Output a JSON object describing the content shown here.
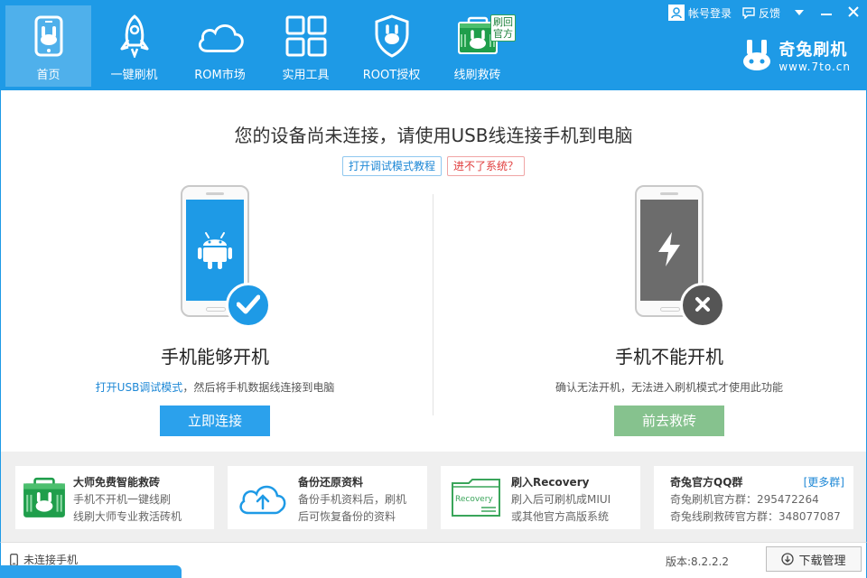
{
  "nav": {
    "items": [
      {
        "label": "首页",
        "icon": "rabbit-phone-icon",
        "active": true
      },
      {
        "label": "一键刷机",
        "icon": "rocket-icon"
      },
      {
        "label": "ROM市场",
        "icon": "cloud-icon"
      },
      {
        "label": "实用工具",
        "icon": "grid-icon"
      },
      {
        "label": "ROOT授权",
        "icon": "shield-icon"
      },
      {
        "label": "线刷救砖",
        "icon": "rescue-kit-icon",
        "badge": "刷回官方"
      }
    ]
  },
  "window_controls": {
    "login_label": "帐号登录",
    "feedback_label": "反馈"
  },
  "brand": {
    "name": "奇兔刷机",
    "url": "www.7to.cn"
  },
  "main": {
    "headline": "您的设备尚未连接，请使用USB线连接手机到电脑",
    "tag_tutorial": "打开调试模式教程",
    "tag_no_system": "进不了系统？",
    "left": {
      "title": "手机能够开机",
      "desc_link": "打开USB调试模式",
      "desc_rest": "，然后将手机数据线连接到电脑",
      "button": "立即连接"
    },
    "right": {
      "title": "手机不能开机",
      "desc": "确认无法开机，无法进入刷机模式才使用此功能",
      "button": "前去救砖"
    }
  },
  "cards": [
    {
      "title": "大师免费智能救砖",
      "line1": "手机不开机一键线刷",
      "line2": "线刷大师专业救活砖机",
      "icon": "rescue-kit-icon"
    },
    {
      "title": "备份还原资料",
      "line1": "备份手机资料后，刷机",
      "line2": "后可恢复备份的资料",
      "icon": "cloud-upload-icon"
    },
    {
      "title": "刷入Recovery",
      "line1": "刷入后可刷机成MIUI",
      "line2": "或其他官方高版系统",
      "icon": "recovery-folder-icon",
      "icon_text": "Recovery"
    },
    {
      "title": "奇兔官方QQ群",
      "more": "[更多群]",
      "line1": "奇兔刷机官方群：295472264",
      "line2": "奇兔线刷救砖官方群：348077087",
      "icon": "none"
    }
  ],
  "status": {
    "phone_status": "未连接手机",
    "version": "版本:8.2.2.2",
    "download_label": "下载管理"
  },
  "colors": {
    "primary": "#1e9ae6",
    "connect_button": "#2ba1ec",
    "rescue_button": "#86c28e",
    "link": "#1e88d6",
    "warning": "#e03c3c"
  }
}
